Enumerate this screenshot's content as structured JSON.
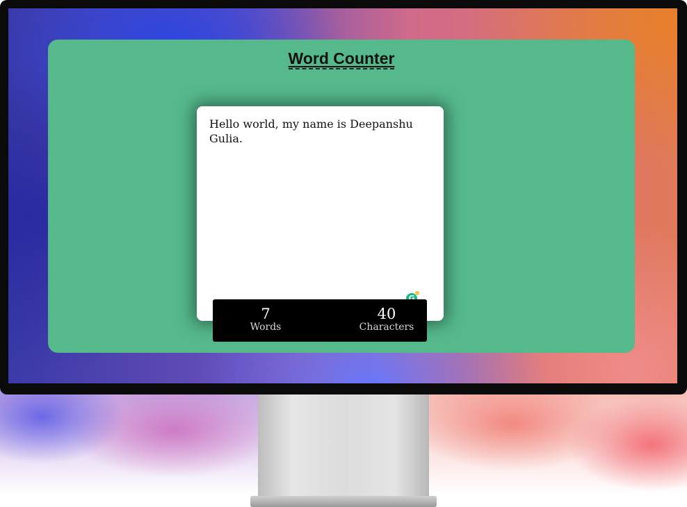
{
  "app": {
    "title": "Word Counter",
    "colors": {
      "panel": "#55b98b",
      "editor_bg": "#ffffff",
      "stats_bg": "#000000",
      "stats_text": "#ffffff"
    }
  },
  "editor": {
    "text": "Hello world, my name is Deepanshu Gulia.",
    "assistant_icon": "grammarly-icon",
    "assistant_glyph": "G"
  },
  "stats": {
    "words_value": "7",
    "words_label": "Words",
    "chars_value": "40",
    "chars_label": "Characters"
  }
}
